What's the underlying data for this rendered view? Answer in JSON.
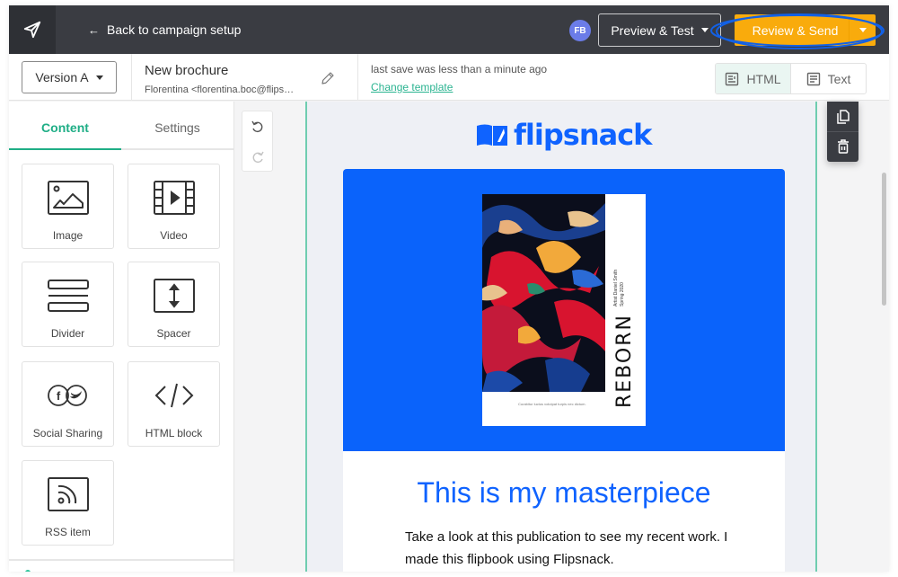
{
  "topbar": {
    "logo_icon": "paper-plane-icon",
    "back_label": "Back to campaign setup",
    "back_icon": "arrow-left-icon",
    "avatar_initials": "FB",
    "avatar_color": "#6b7ce8",
    "preview_label": "Preview & Test",
    "send_label": "Review & Send",
    "send_color": "#f9ab0c"
  },
  "subbar": {
    "version_label": "Version A",
    "campaign_name": "New brochure",
    "campaign_from": "Florentina <florentina.boc@flips…",
    "last_save": "last save was less than a minute ago",
    "change_template": "Change template",
    "view_toggle": [
      {
        "label": "HTML",
        "icon": "html-view-icon",
        "active": true
      },
      {
        "label": "Text",
        "icon": "text-view-icon",
        "active": false
      }
    ]
  },
  "sidebar": {
    "tabs": [
      {
        "label": "Content",
        "active": true
      },
      {
        "label": "Settings",
        "active": false
      }
    ],
    "blocks": [
      {
        "label": "Image",
        "icon": "image-icon"
      },
      {
        "label": "Video",
        "icon": "video-icon"
      },
      {
        "label": "Divider",
        "icon": "divider-icon"
      },
      {
        "label": "Spacer",
        "icon": "spacer-icon"
      },
      {
        "label": "Social Sharing",
        "icon": "social-sharing-icon"
      },
      {
        "label": "HTML block",
        "icon": "code-icon"
      },
      {
        "label": "RSS item",
        "icon": "rss-icon"
      }
    ],
    "accent_color": "#1fae86"
  },
  "email": {
    "brand_name": "flipsnack",
    "brand_color": "#0f63ff",
    "cover": {
      "title": "REBORN",
      "subtitle_line1": "Artist Daniel Smith",
      "subtitle_line2": "Spring 2020",
      "caption": "Curabitur luctus volutpat turpis nec dictum."
    },
    "headline": "This is my masterpiece",
    "paragraph": "Take a look at this publication to see my recent work. I made this flipbook using Flipsnack."
  },
  "floating_tools": [
    {
      "icon": "duplicate-icon"
    },
    {
      "icon": "trash-icon"
    }
  ]
}
